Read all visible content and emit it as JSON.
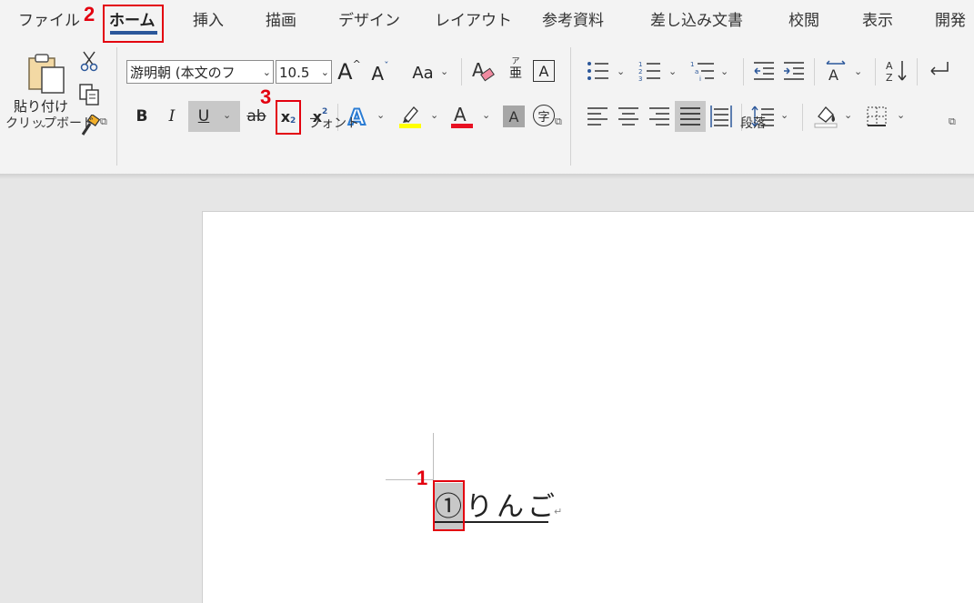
{
  "tabs": [
    {
      "label": "ファイル",
      "active": false
    },
    {
      "label": "ホーム",
      "active": true
    },
    {
      "label": "挿入",
      "active": false
    },
    {
      "label": "描画",
      "active": false
    },
    {
      "label": "デザイン",
      "active": false
    },
    {
      "label": "レイアウト",
      "active": false
    },
    {
      "label": "参考資料",
      "active": false
    },
    {
      "label": "差し込み文書",
      "active": false
    },
    {
      "label": "校閲",
      "active": false
    },
    {
      "label": "表示",
      "active": false
    },
    {
      "label": "開発",
      "active": false
    }
  ],
  "ribbon": {
    "clipboard": {
      "paste_label": "貼り付け",
      "group_label": "クリップボード"
    },
    "font": {
      "font_name": "游明朝 (本文のフ",
      "font_size": "10.5",
      "change_case": "Aa",
      "bold": "B",
      "italic": "I",
      "underline": "U",
      "strike": "ab",
      "subscript": "x",
      "superscript": "x",
      "subscript_small": "2",
      "superscript_small": "2",
      "phonetic": "亜",
      "phonetic_top": "ア",
      "char_border": "A",
      "char_shading": "A",
      "enclose": "字",
      "grow_font": "A",
      "shrink_font": "A",
      "group_label": "フォント"
    },
    "paragraph": {
      "group_label": "段落"
    }
  },
  "document": {
    "text": "①りんご",
    "pilcrow": "↵"
  },
  "annotations": [
    {
      "number": "1"
    },
    {
      "number": "2"
    },
    {
      "number": "3"
    }
  ],
  "colors": {
    "accent": "#2b579a",
    "annotation_red": "#e3000f",
    "highlight_yellow": "#ffff00",
    "font_red": "#e81123",
    "selection_gray": "#c8c8c8"
  }
}
